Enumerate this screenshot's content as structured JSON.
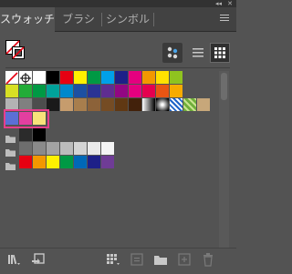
{
  "panel": {
    "tabs": [
      {
        "label": "スウォッチ",
        "active": true
      },
      {
        "label": "ブラシ",
        "active": false
      },
      {
        "label": "シンボル",
        "active": false
      }
    ],
    "collapse_glyph": "◂◂",
    "close_glyph": "✕"
  },
  "toolbar": {
    "fill_stroke_icon": "none-fill-stroke-icon",
    "view_buttons": [
      {
        "name": "show-kind-icon",
        "icon": "color-dots-icon"
      },
      {
        "name": "list-view-icon",
        "icon": "list-icon"
      },
      {
        "name": "thumbnail-view-icon",
        "icon": "grid-icon",
        "active": true
      }
    ]
  },
  "swatch_rows": [
    {
      "items": [
        {
          "kind": "none"
        },
        {
          "kind": "registration"
        },
        {
          "color": "#ffffff"
        },
        {
          "color": "#000000"
        },
        {
          "color": "#e60012"
        },
        {
          "color": "#fff100"
        },
        {
          "color": "#009944"
        },
        {
          "color": "#00a0e9"
        },
        {
          "color": "#1d2088"
        },
        {
          "color": "#e4007f"
        },
        {
          "color": "#f39800"
        },
        {
          "color": "#ffe100"
        },
        {
          "color": "#8fc31f"
        }
      ]
    },
    {
      "items": [
        {
          "color": "#d7df23"
        },
        {
          "color": "#22ac38"
        },
        {
          "color": "#009944"
        },
        {
          "color": "#00a29a"
        },
        {
          "color": "#0088cc"
        },
        {
          "color": "#1d50a2"
        },
        {
          "color": "#2a3394"
        },
        {
          "color": "#5f2d91"
        },
        {
          "color": "#920783"
        },
        {
          "color": "#e4007f"
        },
        {
          "color": "#e5004f"
        },
        {
          "color": "#e95513"
        },
        {
          "color": "#f6ab00"
        }
      ]
    },
    {
      "items": [
        {
          "color": "#b3b3b3"
        },
        {
          "color": "#808080"
        },
        {
          "color": "#4d4d4d"
        },
        {
          "color": "#1a1a1a"
        },
        {
          "color": "#c69c6d"
        },
        {
          "color": "#a87e4d"
        },
        {
          "color": "#8c6239"
        },
        {
          "color": "#754c24"
        },
        {
          "color": "#603813"
        },
        {
          "color": "#42210b"
        },
        {
          "kind": "gradient-bw"
        },
        {
          "kind": "gradient-orange"
        },
        {
          "kind": "pattern-blue"
        },
        {
          "kind": "pattern-green"
        },
        {
          "color": "#c7a77a"
        }
      ]
    },
    {
      "selected": true,
      "items": [
        {
          "color": "#5b6fd6"
        },
        {
          "color": "#e33fa0"
        },
        {
          "color": "#f7e27a"
        }
      ]
    },
    {
      "folder": true,
      "items": [
        {
          "color": "#2b2b2b"
        },
        {
          "color": "#000000"
        }
      ]
    },
    {
      "folder": true,
      "items": [
        {
          "color": "#6e6e6e"
        },
        {
          "color": "#8a8a8a"
        },
        {
          "color": "#a3a3a3"
        },
        {
          "color": "#bcbcbc"
        },
        {
          "color": "#d4d4d4"
        },
        {
          "color": "#e9e9e9"
        },
        {
          "color": "#f5f5f5"
        }
      ]
    },
    {
      "folder": true,
      "items": [
        {
          "color": "#e60012"
        },
        {
          "color": "#f39800"
        },
        {
          "color": "#fff100"
        },
        {
          "color": "#009944"
        },
        {
          "color": "#0068b7"
        },
        {
          "color": "#1d2088"
        },
        {
          "color": "#6f3c96"
        }
      ]
    }
  ],
  "bottom_toolbar": [
    {
      "name": "swatch-libraries-icon"
    },
    {
      "name": "place-swatches-icon"
    },
    {
      "name": "show-swatch-kinds-icon"
    },
    {
      "name": "swatch-options-icon"
    },
    {
      "name": "new-color-group-icon"
    },
    {
      "name": "new-swatch-icon"
    },
    {
      "name": "delete-swatch-icon"
    }
  ]
}
